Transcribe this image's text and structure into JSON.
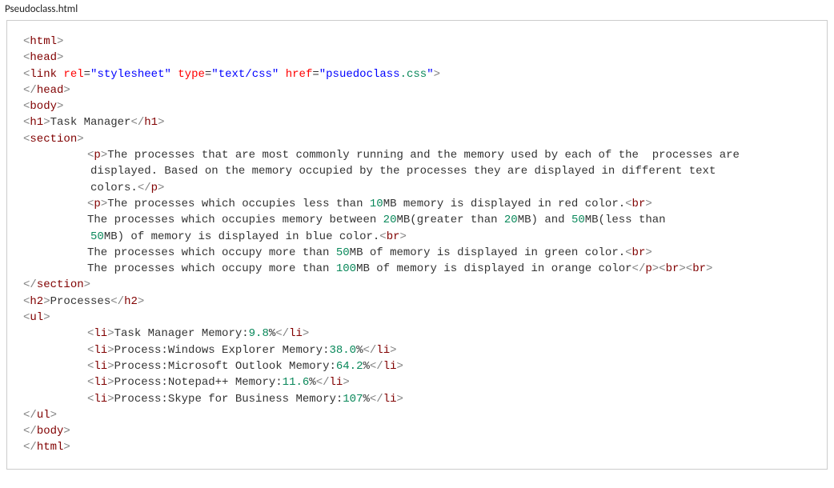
{
  "filename": "Pseudoclass.html",
  "link": {
    "rel": "stylesheet",
    "type": "text/css",
    "href_prefix": "psuedoclass",
    "href_suffix": ".css"
  },
  "h1_text": "Task Manager",
  "p1": "The processes that are most commonly running and the memory used by each of the  processes are displayed. Based on the memory occupied by the processes they are displayed in different text colors.",
  "p2_line1_a": "The processes which occupies less than ",
  "p2_line1_num": "10",
  "p2_line1_b": "MB memory is displayed in red color.",
  "p2_line2_a": "The processes which occupies memory between ",
  "p2_line2_num1": "20",
  "p2_line2_b": "MB(greater than ",
  "p2_line2_num2": "20",
  "p2_line2_c": "MB) and ",
  "p2_line2_num3": "50",
  "p2_line2_d": "MB(less than ",
  "p2_line2_num4": "50",
  "p2_line2_e": "MB) of memory is displayed in blue color.",
  "p2_line3_a": "The processes which occupy more than ",
  "p2_line3_num": "50",
  "p2_line3_b": "MB of memory is displayed in green color.",
  "p2_line4_a": "The processes which occupy more than ",
  "p2_line4_num": "100",
  "p2_line4_b": "MB of memory is displayed in orange color",
  "h2_text": "Processes",
  "li1_a": "Task Manager Memory:",
  "li1_num": "9.8",
  "li1_b": "%",
  "li2_a": "Process:Windows Explorer Memory:",
  "li2_num": "38.0",
  "li2_b": "%",
  "li3_a": "Process:Microsoft Outlook Memory:",
  "li3_num": "64.2",
  "li3_b": "%",
  "li4_a": "Process:Notepad++ Memory:",
  "li4_num": "11.6",
  "li4_b": "%",
  "li5_a": "Process:Skype for Business Memory:",
  "li5_num": "107",
  "li5_b": "%"
}
